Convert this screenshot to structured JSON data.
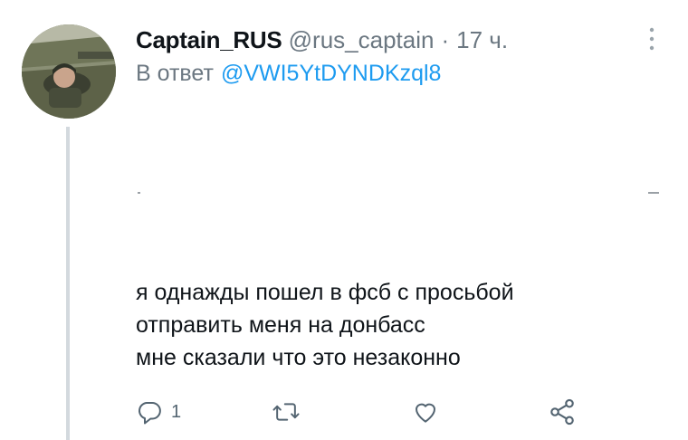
{
  "tweet": {
    "display_name": "Captain_RUS",
    "handle": "@rus_captain",
    "separator": "·",
    "time": "17 ч.",
    "reply_prefix": "В ответ",
    "reply_to": "@VWI5YtDYNDKzql8",
    "text_lines": [
      "я однажды пошел в фсб с просьбой",
      "отправить меня на донбасс",
      "мне сказали что это незаконно"
    ]
  },
  "actions": {
    "reply_count": "1",
    "retweet_count": "",
    "like_count": ""
  },
  "colors": {
    "text_primary": "#0f1419",
    "text_secondary": "#6b7781",
    "link": "#1d9bf0",
    "icon": "#536471",
    "thread_line": "#d3d9de"
  },
  "icons": [
    "more-vertical-icon",
    "reply-icon",
    "retweet-icon",
    "like-icon",
    "share-icon"
  ]
}
